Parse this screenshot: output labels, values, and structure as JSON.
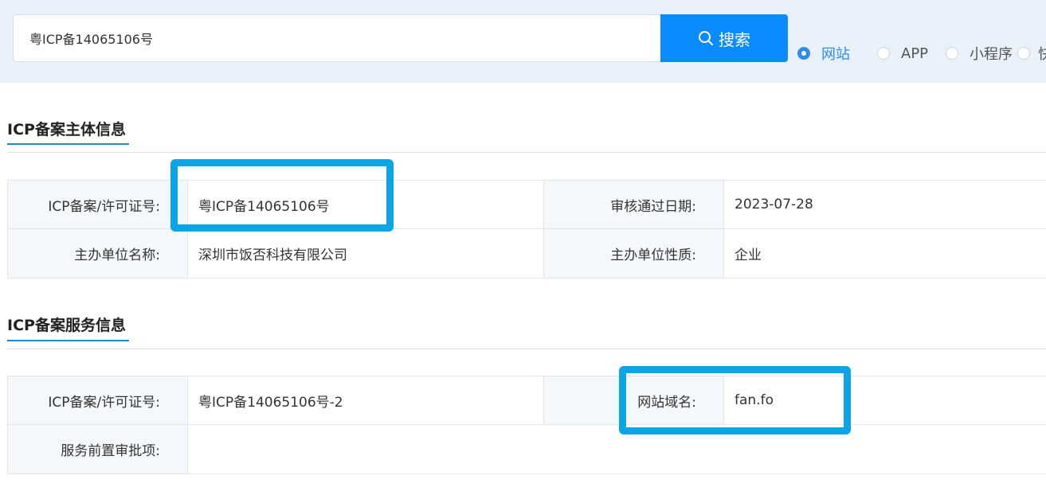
{
  "search": {
    "value": "粤ICP备14065106号",
    "button_label": "搜索"
  },
  "search_types": [
    {
      "label": "网站",
      "checked": true
    },
    {
      "label": "APP",
      "checked": false
    },
    {
      "label": "小程序",
      "checked": false
    },
    {
      "label": "快应",
      "checked": false
    }
  ],
  "subject_section": {
    "title": "ICP备案主体信息",
    "rows": [
      {
        "label1": "ICP备案/许可证号:",
        "value1": "粤ICP备14065106号",
        "label2": "审核通过日期:",
        "value2": "2023-07-28"
      },
      {
        "label1": "主办单位名称:",
        "value1": "深圳市饭否科技有限公司",
        "label2": "主办单位性质:",
        "value2": "企业"
      }
    ]
  },
  "service_section": {
    "title": "ICP备案服务信息",
    "row1": {
      "label1": "ICP备案/许可证号:",
      "value1": "粤ICP备14065106号-2",
      "label2": "网站域名:",
      "value2": "fan.fo"
    },
    "row2": {
      "label1": "服务前置审批项:",
      "value1": ""
    }
  },
  "colors": {
    "accent": "#0a8bff",
    "radio_checked": "#2d8cf0",
    "highlight": "#0aa5e6",
    "header_bg": "#e9f1fb"
  }
}
